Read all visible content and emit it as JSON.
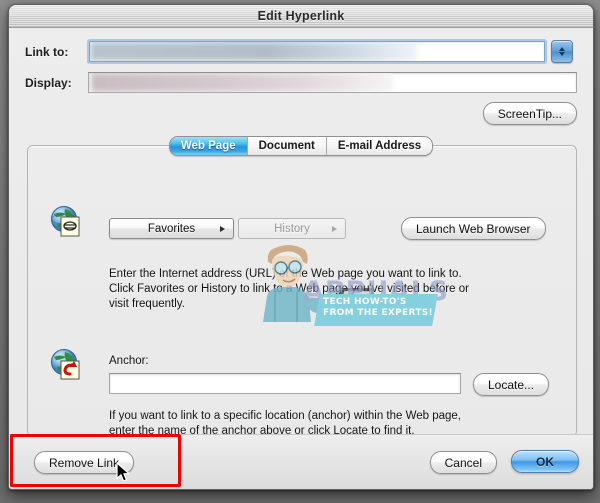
{
  "window": {
    "title": "Edit Hyperlink"
  },
  "fields": {
    "link_to_label": "Link to:",
    "link_to_value": "",
    "display_label": "Display:",
    "display_value": ""
  },
  "toolbar": {
    "screentip_label": "ScreenTip..."
  },
  "tabs": [
    {
      "label": "Web Page",
      "active": true
    },
    {
      "label": "Document",
      "active": false
    },
    {
      "label": "E-mail Address",
      "active": false
    }
  ],
  "web_page_panel": {
    "favorites_label": "Favorites",
    "history_label": "History",
    "launch_browser_label": "Launch Web Browser",
    "url_help_text": "Enter the Internet address (URL) of the Web page you want to link to. Click Favorites or History to link to a Web page you've visited before or visit frequently.",
    "anchor_label": "Anchor:",
    "anchor_value": "",
    "locate_label": "Locate...",
    "anchor_help_text": "If you want to link to a specific location (anchor) within the Web page, enter the name of the anchor above or click Locate to find it."
  },
  "footer": {
    "remove_link_label": "Remove Link",
    "cancel_label": "Cancel",
    "ok_label": "OK"
  },
  "watermark": {
    "brand": "APPUALS",
    "tagline": "TECH HOW-TO'S FROM THE EXPERTS!"
  },
  "colors": {
    "accent_blue": "#3f97e6",
    "tab_active": "#2a93dc",
    "annotation_red": "#f00000",
    "watermark_teal": "#6fcbdc",
    "window_bg": "#ececec"
  }
}
